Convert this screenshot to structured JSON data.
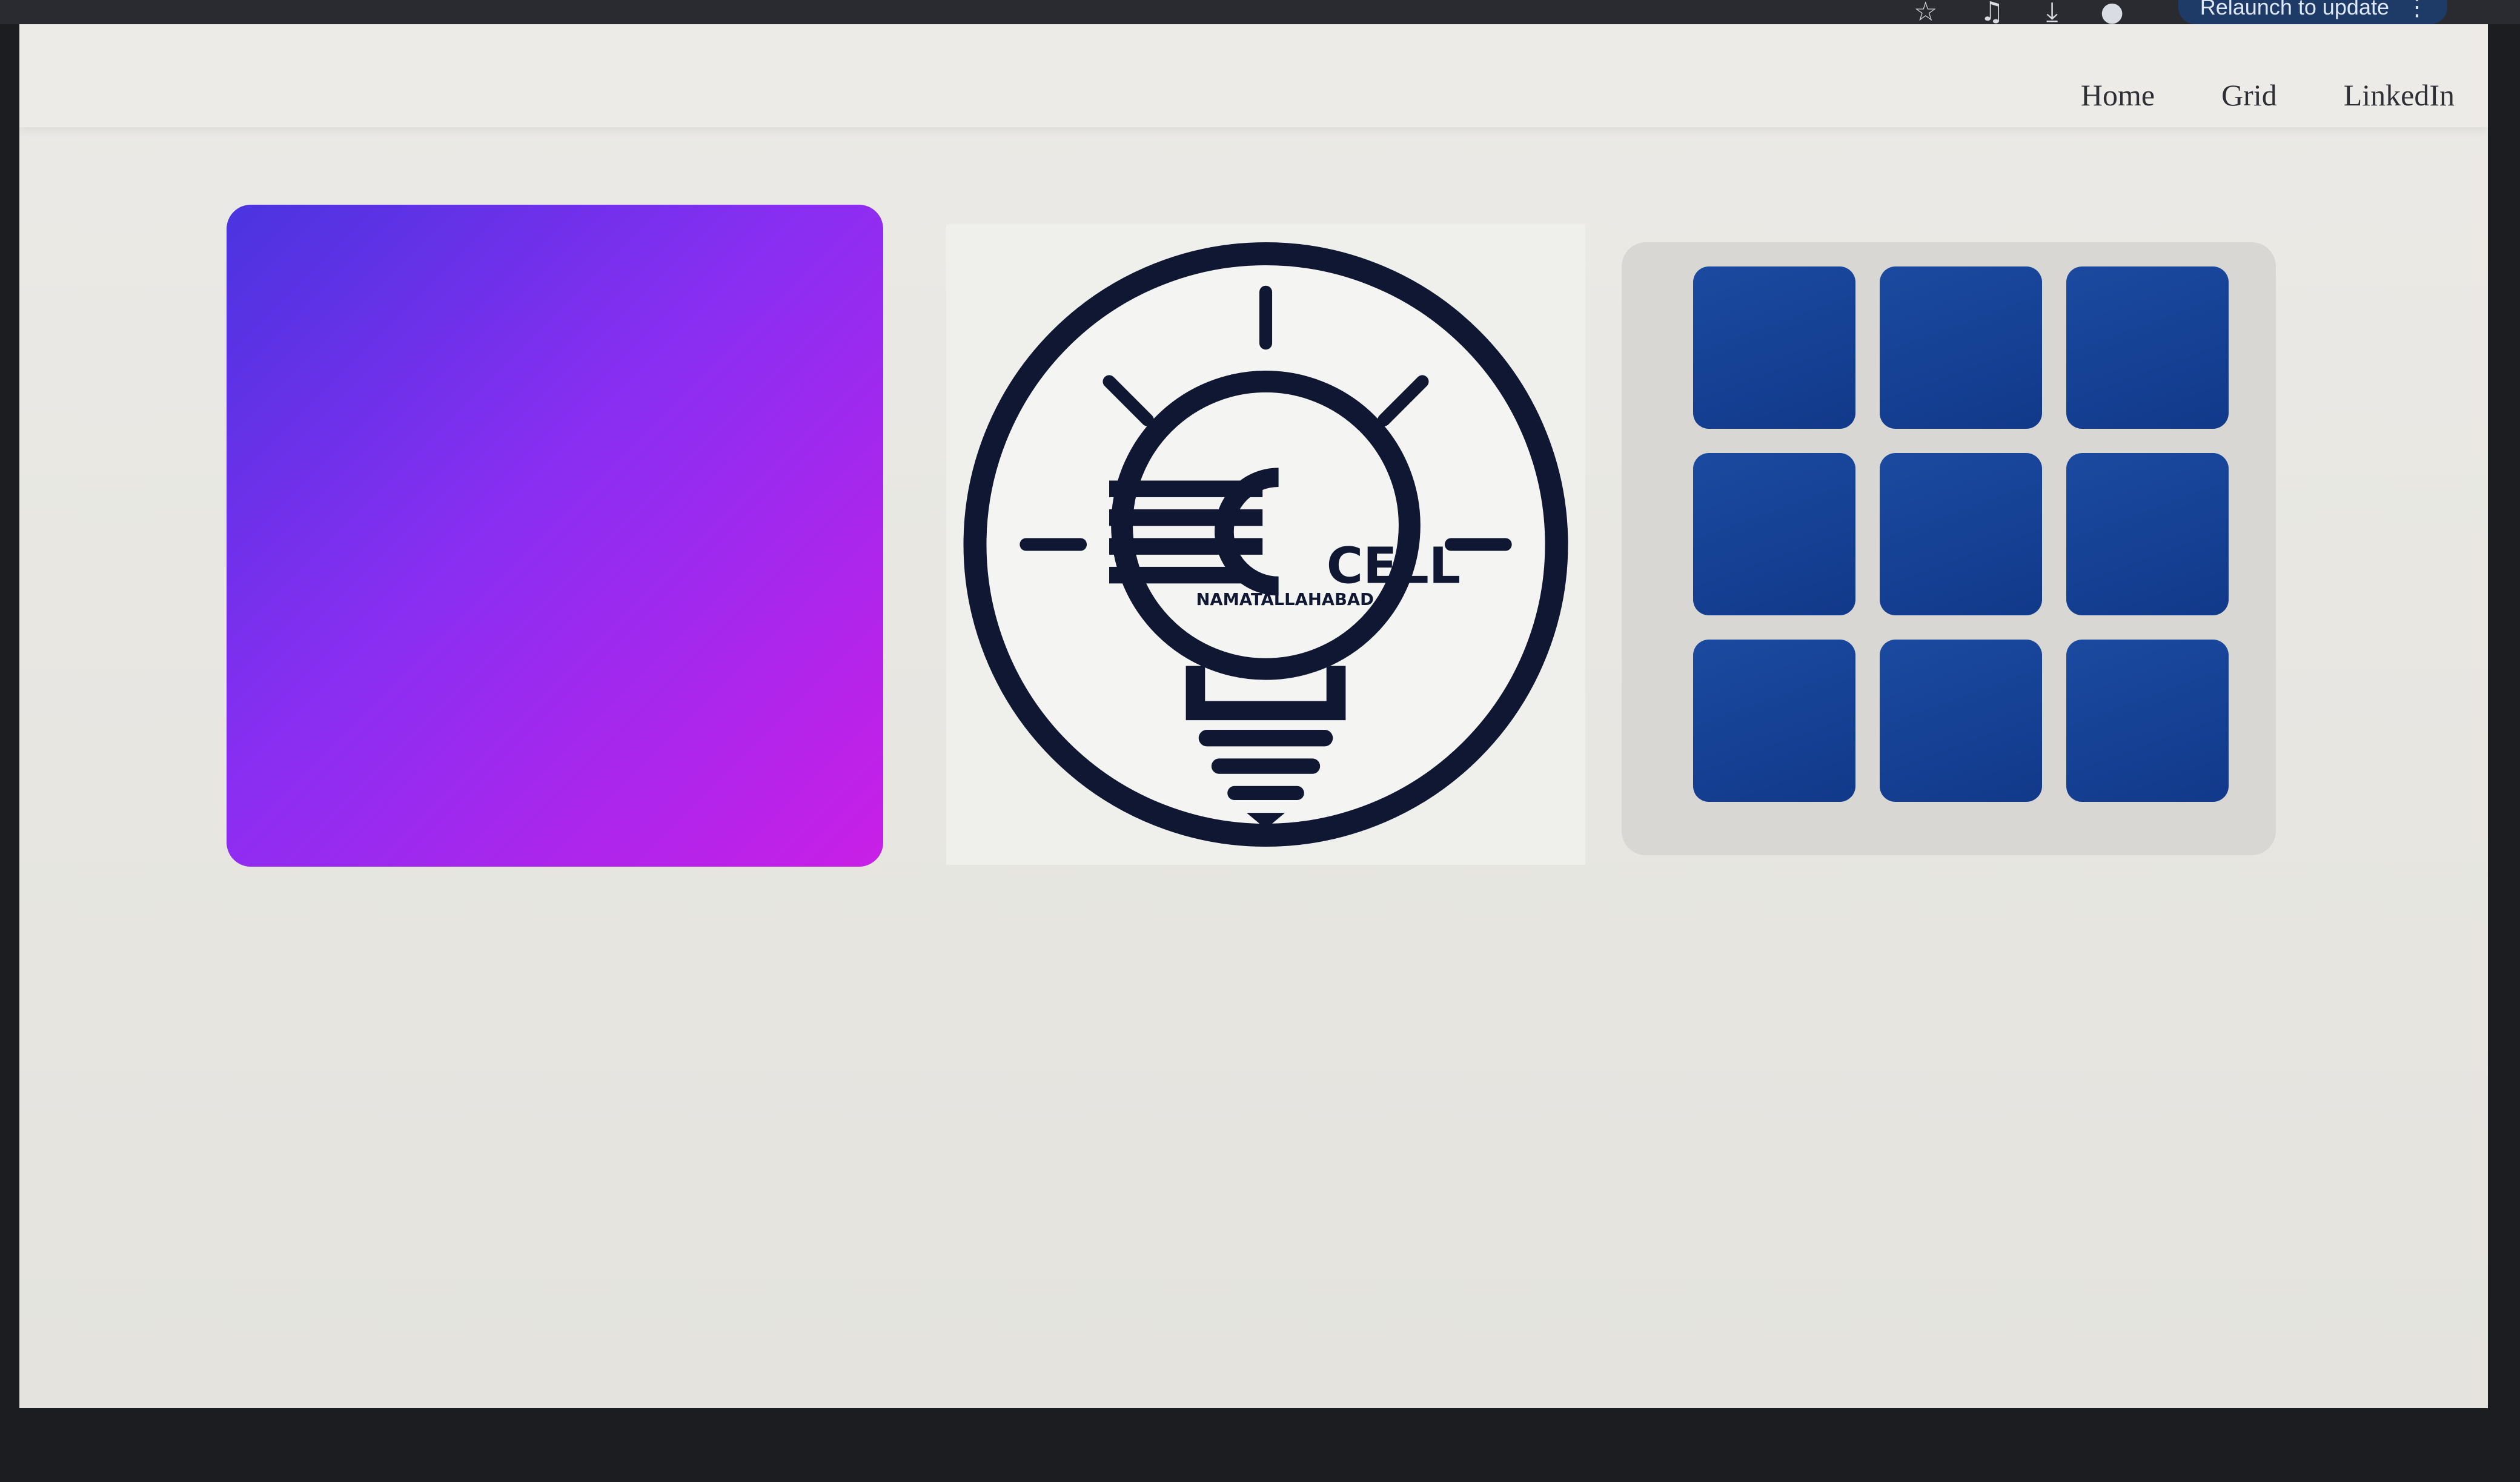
{
  "browser": {
    "icons": [
      "star-icon",
      "extension-icon",
      "download-icon",
      "profile-icon"
    ],
    "relaunch_label": "Relaunch to update"
  },
  "nav": {
    "links": [
      "Home",
      "Grid",
      "LinkedIn"
    ]
  },
  "logo": {
    "wordmark": "CELL",
    "tagline": "NAMATALLAHABAD"
  },
  "colors": {
    "gradient_start": "#4a34e0",
    "gradient_end": "#c91fe6",
    "tile": "#1a4aa0",
    "logo_ink": "#0f1733"
  },
  "grid": {
    "rows": 3,
    "cols": 3
  }
}
